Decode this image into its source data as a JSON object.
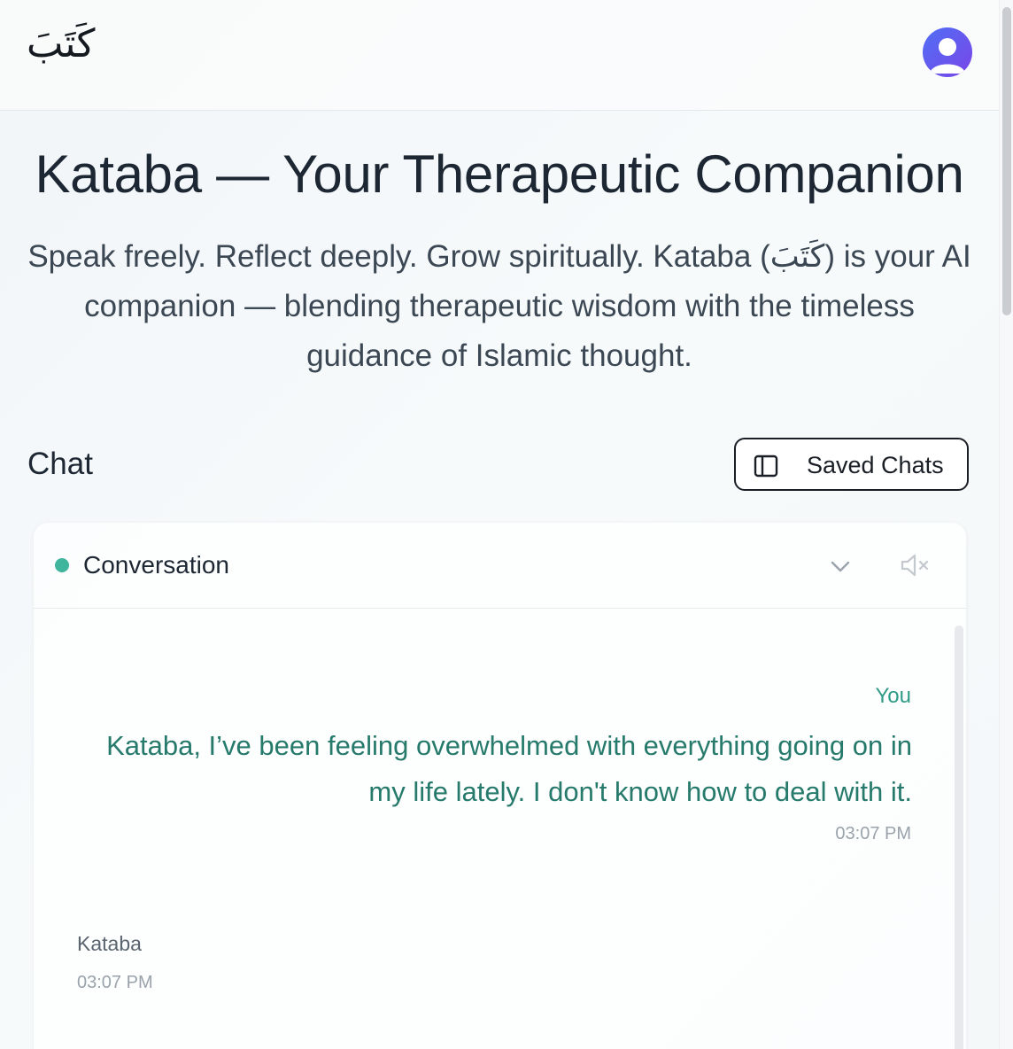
{
  "header": {
    "logo_text": "كَتَبَ",
    "avatar_icon": "user-icon"
  },
  "hero": {
    "title": "Kataba — Your Therapeutic Companion",
    "subtitle": "Speak freely. Reflect deeply. Grow spiritually. Kataba (كَتَبَ) is your AI companion — blending therapeutic wisdom with the timeless guidance of Islamic thought."
  },
  "chat": {
    "label": "Chat",
    "saved_chats_label": "Saved Chats",
    "saved_chats_icon": "sidebar-panel-icon"
  },
  "conversation": {
    "title": "Conversation",
    "status_color": "#3fb59d",
    "collapse_icon": "chevron-down-icon",
    "mute_icon": "speaker-muted-icon",
    "messages": [
      {
        "sender": "You",
        "text": "Kataba, I’ve been feeling overwhelmed with everything going on in my life lately. I don't know how to deal with it.",
        "time": "03:07 PM"
      },
      {
        "sender": "Kataba",
        "text": "",
        "time": "03:07 PM"
      }
    ]
  },
  "colors": {
    "accent_teal": "#2f9a86",
    "avatar_gradient_start": "#4f6ff5",
    "avatar_gradient_end": "#7b45e8"
  }
}
